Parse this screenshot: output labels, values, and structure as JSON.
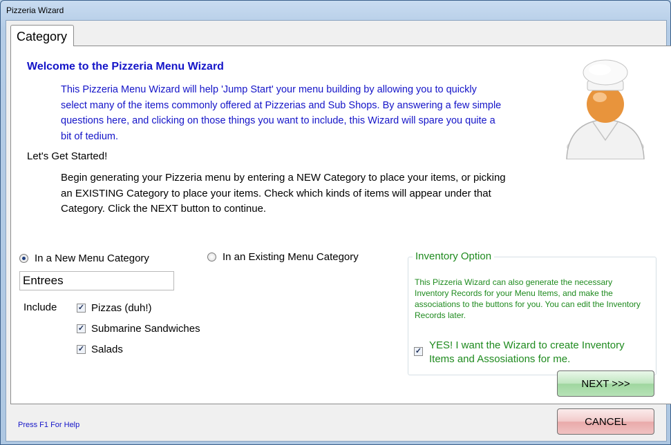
{
  "window": {
    "title": "Pizzeria Wizard"
  },
  "tabs": [
    {
      "label": "Category"
    }
  ],
  "welcome": {
    "title": "Welcome to the Pizzeria Menu Wizard",
    "body": "This Pizzeria Menu Wizard will help 'Jump Start' your menu building by allowing you to quickly select many of the items commonly offered at Pizzerias and Sub Shops.  By answering a few simple questions here, and clicking on those things you want to include, this Wizard will spare you quite a bit of tedium."
  },
  "started": {
    "title": "Let's Get Started!",
    "body": "Begin generating your Pizzeria menu by entering a NEW Category to place your items, or picking an EXISTING Category to place your items.  Check which kinds of items will appear under that Category.  Click the NEXT button to continue."
  },
  "category_mode": {
    "new_label": "In a New Menu Category",
    "existing_label": "In an Existing Menu Category",
    "selected": "new"
  },
  "category_name": {
    "value": "Entrees"
  },
  "include": {
    "label": "Include",
    "items": [
      {
        "label": "Pizzas (duh!)",
        "checked": true
      },
      {
        "label": "Submarine Sandwiches",
        "checked": true
      },
      {
        "label": "Salads",
        "checked": true
      }
    ]
  },
  "inventory": {
    "title": "Inventory Option",
    "description": "This Pizzeria Wizard can also generate the necessary Inventory Records for your Menu Items, and make the associations to the buttons for you. You can edit the Inventory Records later.",
    "checkbox_label": "YES!  I want the Wizard to create Inventory Items and Assosiations for me.",
    "checked": true
  },
  "buttons": {
    "next": "NEXT >>>",
    "cancel": "CANCEL"
  },
  "footer": {
    "help": "Press F1 For Help"
  },
  "icons": {
    "chef": "chef-avatar-icon"
  },
  "colors": {
    "heading": "#1414c8",
    "inventory": "#1e8a1e",
    "next_button": "#b7e3b7",
    "cancel_button": "#f0c2c2"
  }
}
